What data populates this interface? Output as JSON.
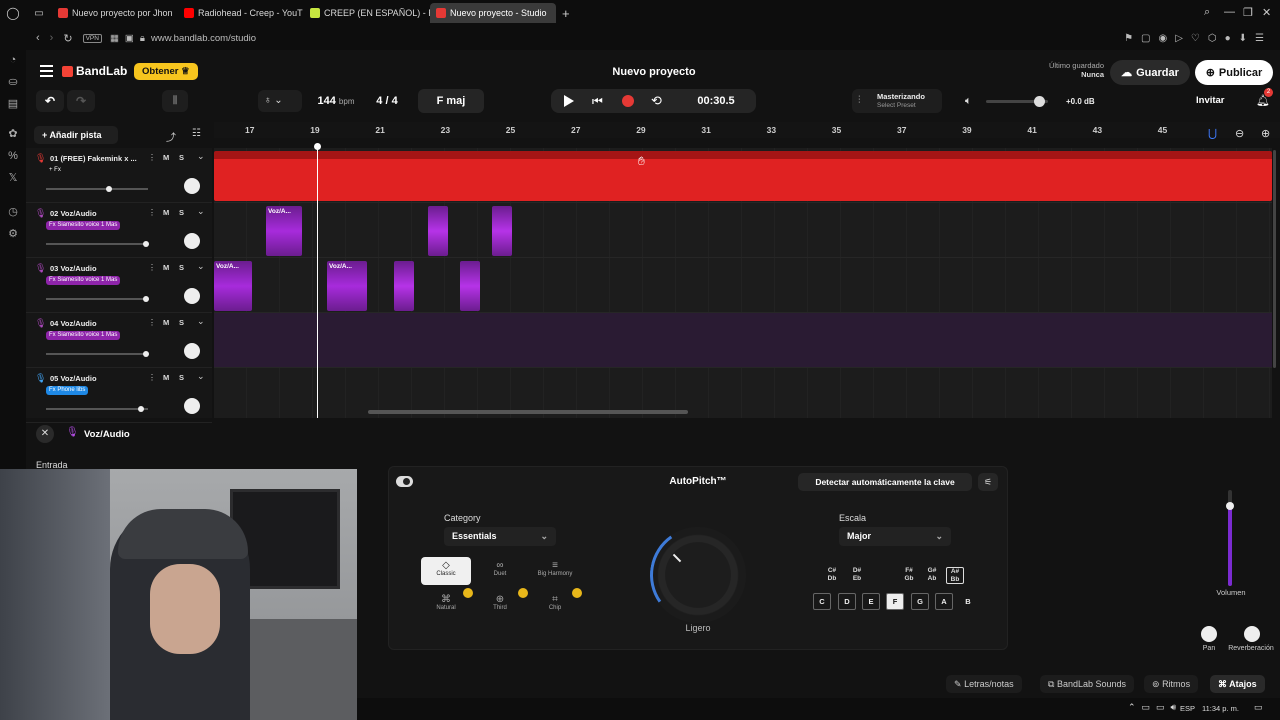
{
  "browser": {
    "tabs": [
      {
        "label": "Nuevo proyecto por Jhon",
        "color": "#e53935"
      },
      {
        "label": "Radiohead - Creep - YouT",
        "color": "#ff0000"
      },
      {
        "label": "CREEP (EN ESPAÑOL) - Ra",
        "color": "#c6e640"
      },
      {
        "label": "Nuevo proyecto - Studio",
        "color": "#e53935"
      }
    ],
    "new_tab": "+",
    "url": "www.bandlab.com/studio",
    "vpn": "VPN"
  },
  "app": {
    "brand": "BandLab",
    "get_button": "Obtener",
    "project_title": "Nuevo proyecto",
    "last_saved_label": "Último guardado",
    "last_saved_value": "Nunca",
    "save_button": "Guardar",
    "publish_button": "Publicar",
    "invite_button": "Invitar",
    "notif_count": "2"
  },
  "transport": {
    "bpm": "144",
    "bpm_unit": "bpm",
    "time_signature": "4 / 4",
    "key": "F maj",
    "time": "00:30.5",
    "mastering_label": "Masterizando",
    "mastering_preset": "Select Preset",
    "master_db": "+0.0 dB",
    "master_volume": 0.85
  },
  "ruler": [
    "17",
    "19",
    "21",
    "23",
    "25",
    "27",
    "29",
    "31",
    "33",
    "35",
    "37",
    "39",
    "41",
    "43",
    "45"
  ],
  "add_track": "Añadir pista",
  "tracks": [
    {
      "num": "01",
      "name": "(FREE) Fakemink x ...",
      "fx": "+ Fx",
      "fx_color": "transparent",
      "volume": 0.62,
      "icon_color": "#e53935"
    },
    {
      "num": "02",
      "name": "Voz/Audio",
      "fx": "Fx Siamesito voice 1 Mas",
      "fx_color": "#8e24aa",
      "volume": 0.98,
      "icon_color": "#ab47bc"
    },
    {
      "num": "03",
      "name": "Voz/Audio",
      "fx": "Fx Siamesito voice 1 Mas",
      "fx_color": "#8e24aa",
      "volume": 0.98,
      "icon_color": "#ab47bc"
    },
    {
      "num": "04",
      "name": "Voz/Audio",
      "fx": "Fx Siamesito voice 1 Mas",
      "fx_color": "#8e24aa",
      "volume": 0.98,
      "icon_color": "#ab47bc"
    },
    {
      "num": "05",
      "name": "Voz/Audio",
      "fx": "Fx Phone libs",
      "fx_color": "#1e88e5",
      "volume": 0.93,
      "icon_color": "#42a5f5"
    }
  ],
  "track_buttons": {
    "mute": "M",
    "solo": "S"
  },
  "clip_label": "Voz/A...",
  "panel": {
    "track_name": "Voz/Audio",
    "input_label": "Entrada",
    "title": "AutoPitch™",
    "detect_key": "Detectar automáticamente la clave",
    "category_label": "Category",
    "category_value": "Essentials",
    "scale_label": "Escala",
    "scale_value": "Major",
    "presets": [
      {
        "label": "Classic",
        "active": true
      },
      {
        "label": "Duet",
        "active": false
      },
      {
        "label": "Big Harmony",
        "active": false
      },
      {
        "label": "Natural",
        "active": false
      },
      {
        "label": "Third",
        "active": false
      },
      {
        "label": "Chip",
        "active": false
      }
    ],
    "dial_label": "Ligero",
    "sharps": [
      "C# Db",
      "D# Eb",
      "F# Gb",
      "G# Ab",
      "A# Bb"
    ],
    "notes": [
      "C",
      "D",
      "E",
      "F",
      "G",
      "A",
      "B"
    ],
    "volume_label": "Volumen",
    "pan_label": "Pan",
    "reverb_label": "Reverberación"
  },
  "bottom": {
    "lyrics": "Letras/notas",
    "sounds": "BandLab Sounds",
    "rhythms": "Ritmos",
    "shortcuts": "Atajos"
  },
  "taskbar": {
    "lang": "ESP",
    "time": "11:34 p. m."
  }
}
